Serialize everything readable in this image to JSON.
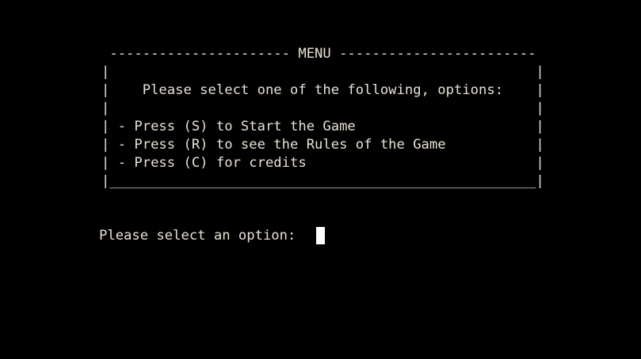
{
  "menu_box": {
    "top_border": " ---------------------- MENU ------------------------",
    "blank_1": "|                                                    |",
    "prompt_row": "|    Please select one of the following, options:    |",
    "blank_2": "|                                                    |",
    "option_start": "| - Press (S) to Start the Game                      |",
    "option_rules": "| - Press (R) to see the Rules of the Game           |",
    "option_credits": "| - Press (C) for credits                            |",
    "bottom_border": "|____________________________________________________|"
  },
  "input": {
    "prompt": "Please select an option:"
  },
  "colors": {
    "background": "#000000",
    "text": "#e8e2d6",
    "cursor": "#ffffff"
  }
}
